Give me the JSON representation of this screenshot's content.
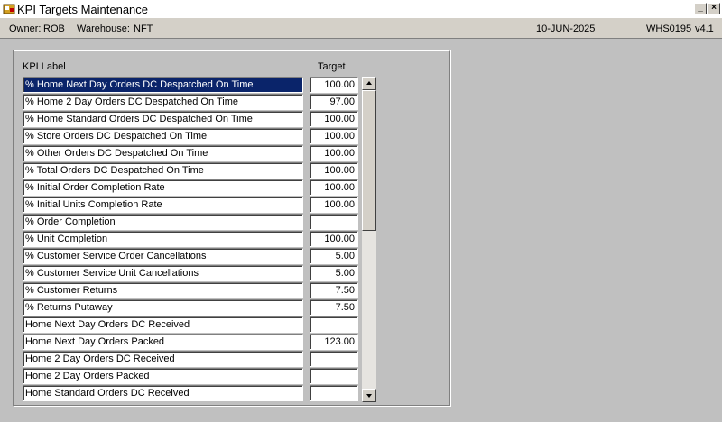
{
  "window": {
    "title": "KPI Targets Maintenance",
    "minimize_glyph": "_",
    "close_glyph": "×"
  },
  "infobar": {
    "owner_label": "Owner:",
    "owner_value": "ROB",
    "warehouse_label": "Warehouse:",
    "warehouse_value": "NFT",
    "date": "10-JUN-2025",
    "form_id": "WHS0195",
    "version": "v4.1"
  },
  "columns": {
    "label": "KPI Label",
    "target": "Target"
  },
  "colors": {
    "selected_row_bg": "#0a246a",
    "background": "#c0c0c0"
  },
  "rows": [
    {
      "label": "% Home Next Day Orders DC Despatched On Time",
      "target": "100.00"
    },
    {
      "label": "% Home 2 Day Orders DC Despatched On Time",
      "target": "97.00"
    },
    {
      "label": "% Home Standard Orders DC Despatched On Time",
      "target": "100.00"
    },
    {
      "label": "% Store Orders DC Despatched On Time",
      "target": "100.00"
    },
    {
      "label": "% Other Orders DC Despatched On Time",
      "target": "100.00"
    },
    {
      "label": "% Total Orders DC Despatched On Time",
      "target": "100.00"
    },
    {
      "label": "% Initial Order Completion Rate",
      "target": "100.00"
    },
    {
      "label": "% Initial Units Completion Rate",
      "target": "100.00"
    },
    {
      "label": "% Order Completion",
      "target": ""
    },
    {
      "label": "% Unit Completion",
      "target": "100.00"
    },
    {
      "label": "% Customer Service Order Cancellations",
      "target": "5.00"
    },
    {
      "label": "% Customer Service Unit Cancellations",
      "target": "5.00"
    },
    {
      "label": "% Customer Returns",
      "target": "7.50"
    },
    {
      "label": "% Returns Putaway",
      "target": "7.50"
    },
    {
      "label": "Home Next Day Orders DC Received",
      "target": ""
    },
    {
      "label": "Home Next Day Orders Packed",
      "target": "123.00"
    },
    {
      "label": "Home 2 Day Orders DC Received",
      "target": ""
    },
    {
      "label": "Home 2 Day Orders Packed",
      "target": ""
    },
    {
      "label": "Home Standard Orders DC Received",
      "target": ""
    }
  ],
  "selected_row": 0,
  "scroll_position": 0.0
}
